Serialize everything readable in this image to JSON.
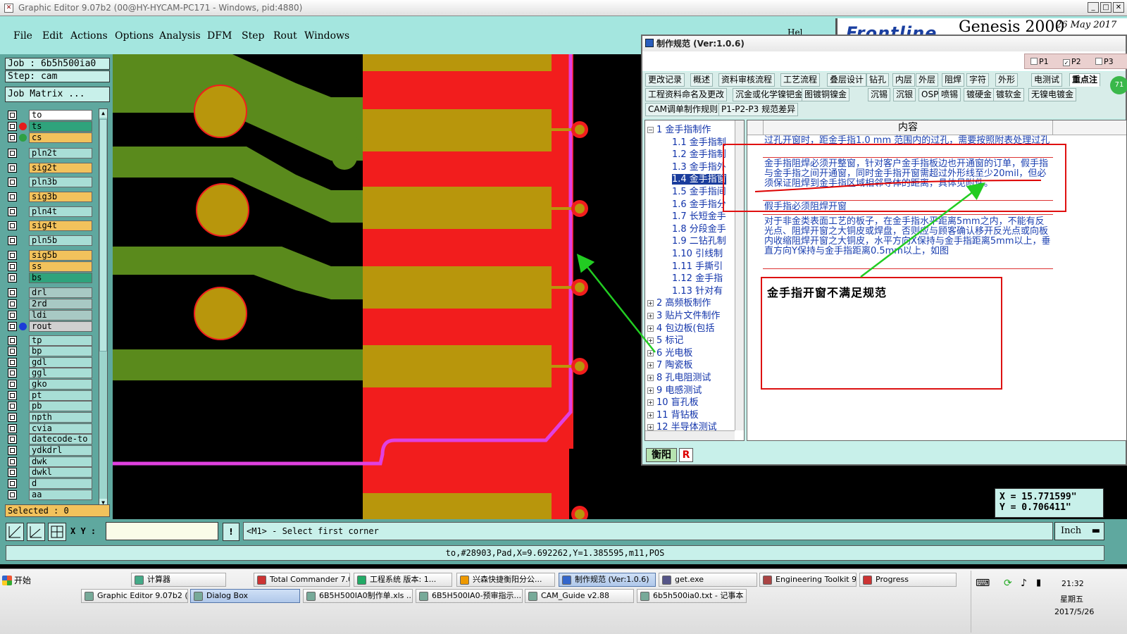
{
  "main_window": {
    "title": "Graphic Editor 9.07b2 (00@HY-HYCAM-PC171 - Windows, pid:4880)",
    "menu": [
      "File",
      "Edit",
      "Actions",
      "Options",
      "Analysis",
      "DFM",
      "Step",
      "Rout",
      "Windows"
    ],
    "menu_extra": "Hel",
    "frontline": {
      "logo": "Frontline",
      "product": "Genesis 2000",
      "date": "26 May 2017"
    }
  },
  "left_panel": {
    "job": "Job : 6b5h500ia0",
    "step": "Step: cam",
    "job_matrix": "Job Matrix ...",
    "layers": [
      {
        "name": "to",
        "color": "#ffffff",
        "dot": null
      },
      {
        "name": "ts",
        "color": "#2fa37c",
        "dot": "#e51c1c"
      },
      {
        "name": "cs",
        "color": "#f2c25c",
        "dot": "#2fa043"
      },
      {
        "name": "pln2t",
        "color": "#a8ded6",
        "dot": null
      },
      {
        "name": "sig2t",
        "color": "#f2c25c",
        "dot": null
      },
      {
        "name": "pln3b",
        "color": "#a8ded6",
        "dot": null
      },
      {
        "name": "sig3b",
        "color": "#f2c25c",
        "dot": null
      },
      {
        "name": "pln4t",
        "color": "#a8ded6",
        "dot": null
      },
      {
        "name": "sig4t",
        "color": "#f2c25c",
        "dot": null
      },
      {
        "name": "pln5b",
        "color": "#a8ded6",
        "dot": null
      },
      {
        "name": "sig5b",
        "color": "#f2c25c",
        "dot": null
      },
      {
        "name": "ss",
        "color": "#f2c25c",
        "dot": null
      },
      {
        "name": "bs",
        "color": "#2fa37c",
        "dot": null
      },
      {
        "name": "drl",
        "color": "#a8c9c4",
        "dot": null
      },
      {
        "name": "2rd",
        "color": "#a8c9c4",
        "dot": null
      },
      {
        "name": "ldi",
        "color": "#a8c9c4",
        "dot": null
      },
      {
        "name": "rout",
        "color": "#d0d0d0",
        "dot": "#1c3cd8"
      },
      {
        "name": "tp",
        "color": "#a8ded6",
        "dot": null
      },
      {
        "name": "bp",
        "color": "#a8ded6",
        "dot": null
      },
      {
        "name": "gdl",
        "color": "#a8ded6",
        "dot": null
      },
      {
        "name": "ggl",
        "color": "#a8ded6",
        "dot": null
      },
      {
        "name": "gko",
        "color": "#a8ded6",
        "dot": null
      },
      {
        "name": "pt",
        "color": "#a8ded6",
        "dot": null
      },
      {
        "name": "pb",
        "color": "#a8ded6",
        "dot": null
      },
      {
        "name": "npth",
        "color": "#a8ded6",
        "dot": null
      },
      {
        "name": "cvia",
        "color": "#a8ded6",
        "dot": null
      },
      {
        "name": "datecode-to",
        "color": "#a8ded6",
        "dot": null
      },
      {
        "name": "ydkdrl",
        "color": "#a8ded6",
        "dot": null
      },
      {
        "name": "dwk",
        "color": "#a8ded6",
        "dot": null
      },
      {
        "name": "dwkl",
        "color": "#a8ded6",
        "dot": null
      },
      {
        "name": "d",
        "color": "#a8ded6",
        "dot": null
      },
      {
        "name": "aa",
        "color": "#a8ded6",
        "dot": null
      }
    ],
    "selected": "Selected : 0"
  },
  "command_bar": {
    "xy_label": "X Y :",
    "xy_value": "",
    "message": "<M1> - Select first corner",
    "unit": "Inch"
  },
  "status_line": "to,#28903,Pad,X=9.692262,Y=1.385595,m11,POS",
  "coordinates": {
    "x": "X = 15.771599\"",
    "y": "Y = 0.706411\""
  },
  "spec_dialog": {
    "title": "制作规范 (Ver:1.0.6)",
    "p_checks": [
      {
        "label": "P1",
        "checked": false
      },
      {
        "label": "P2",
        "checked": true
      },
      {
        "label": "P3",
        "checked": false
      }
    ],
    "tabs_row1": [
      "更改记录",
      "概述",
      "资料审核流程",
      "工艺流程",
      "叠层设计",
      "钻孔",
      "内层",
      "外层",
      "阻焊",
      "字符",
      "外形",
      "电测试",
      "重点注"
    ],
    "tabs_row2": [
      "工程资料命名及更改",
      "沉金或化学镍钯金",
      "图镀铜镍金",
      "沉锡",
      "沉银",
      "OSP",
      "喷锡",
      "镀硬金",
      "镀软金",
      "无镍电镀金"
    ],
    "tabs_row3": [
      "CAM调单制作规则",
      "P1-P2-P3 规范差异"
    ],
    "tab_badge": "71",
    "tree": [
      {
        "label": "1 金手指制作",
        "level": 0,
        "pm": "-"
      },
      {
        "label": "1.1 金手指制",
        "level": 1
      },
      {
        "label": "1.2 金手指制",
        "level": 1
      },
      {
        "label": "1.3 金手指外",
        "level": 1
      },
      {
        "label": "1.4 金手指窗",
        "level": 1,
        "selected": true
      },
      {
        "label": "1.5 金手指间",
        "level": 1
      },
      {
        "label": "1.6 金手指分",
        "level": 1
      },
      {
        "label": "1.7 长短金手",
        "level": 1
      },
      {
        "label": "1.8 分段金手",
        "level": 1
      },
      {
        "label": "1.9 二钻孔制",
        "level": 1
      },
      {
        "label": "1.10 引线制",
        "level": 1
      },
      {
        "label": "1.11 手撕引",
        "level": 1
      },
      {
        "label": "1.12 金手指",
        "level": 1
      },
      {
        "label": "1.13 针对有",
        "level": 1
      },
      {
        "label": "2 高频板制作",
        "level": 0,
        "pm": "+"
      },
      {
        "label": "3 贴片文件制作",
        "level": 0,
        "pm": "+"
      },
      {
        "label": "4 包边板(包括",
        "level": 0,
        "pm": "+"
      },
      {
        "label": "5 标记",
        "level": 0,
        "pm": "+"
      },
      {
        "label": "6 光电板",
        "level": 0,
        "pm": "+"
      },
      {
        "label": "7 陶瓷板",
        "level": 0,
        "pm": "+"
      },
      {
        "label": "8 孔电阻测试",
        "level": 0,
        "pm": "+"
      },
      {
        "label": "9 电感测试",
        "level": 0,
        "pm": "+"
      },
      {
        "label": "10 盲孔板",
        "level": 0,
        "pm": "+"
      },
      {
        "label": "11 背钻板",
        "level": 0,
        "pm": "+"
      },
      {
        "label": "12 半导体测试",
        "level": 0,
        "pm": "+"
      }
    ],
    "grid_header": "内容",
    "rows": [
      "过孔开窗时，距金手指1.0 mm 范围内的过孔，需要按照附表处理过孔",
      "金手指阻焊必须开整窗，针对客户金手指板边也开通窗的订单，假手指与金手指之间开通窗，同时金手指开窗需超过外形线至少20mil，但必须保证阻焊到金手指区域相邻导体的距离，具体见附件。",
      "假手指必须阻焊开窗",
      "对于非金类表面工艺的板子，在金手指水平距离5mm之内，不能有反光点、阻焊开窗之大铜皮或焊盘，否则应与顾客确认移开反光点或向板内收缩阻焊开窗之大铜皮，水平方向X保持与金手指距离5mm以上，垂直方向Y保持与金手指距离0.5mm以上，如图"
    ],
    "bottom_label": "衡阳",
    "bottom_r": "R"
  },
  "annotation": {
    "text": "金手指开窗不满足规范"
  },
  "taskbar": {
    "start": "开始",
    "row1": [
      "计算器",
      "Total Commander 7.0...",
      "工程系统 版本: 1...",
      "兴森快捷衡阳分公...",
      "制作规范 (Ver:1.0.6)",
      "get.exe",
      "Engineering Toolkit 9....",
      "Progress"
    ],
    "row2": [
      "Graphic Editor 9.07b2 (0...",
      "Dialog Box",
      "6B5H500IA0制作单.xls ...",
      "6B5H500IA0-预审指示....",
      "CAM_Guide v2.88",
      "6b5h500ia0.txt - 记事本"
    ],
    "time": "21:32",
    "weekday": "星期五",
    "date": "2017/5/26"
  },
  "colors": {
    "panel_teal": "#5fa89f",
    "light_teal": "#c8f0ea",
    "copper": "#b8960c",
    "mask_green": "#5a8a1c",
    "board_red": "#f21d1d",
    "rout_magenta": "#e040e0"
  }
}
